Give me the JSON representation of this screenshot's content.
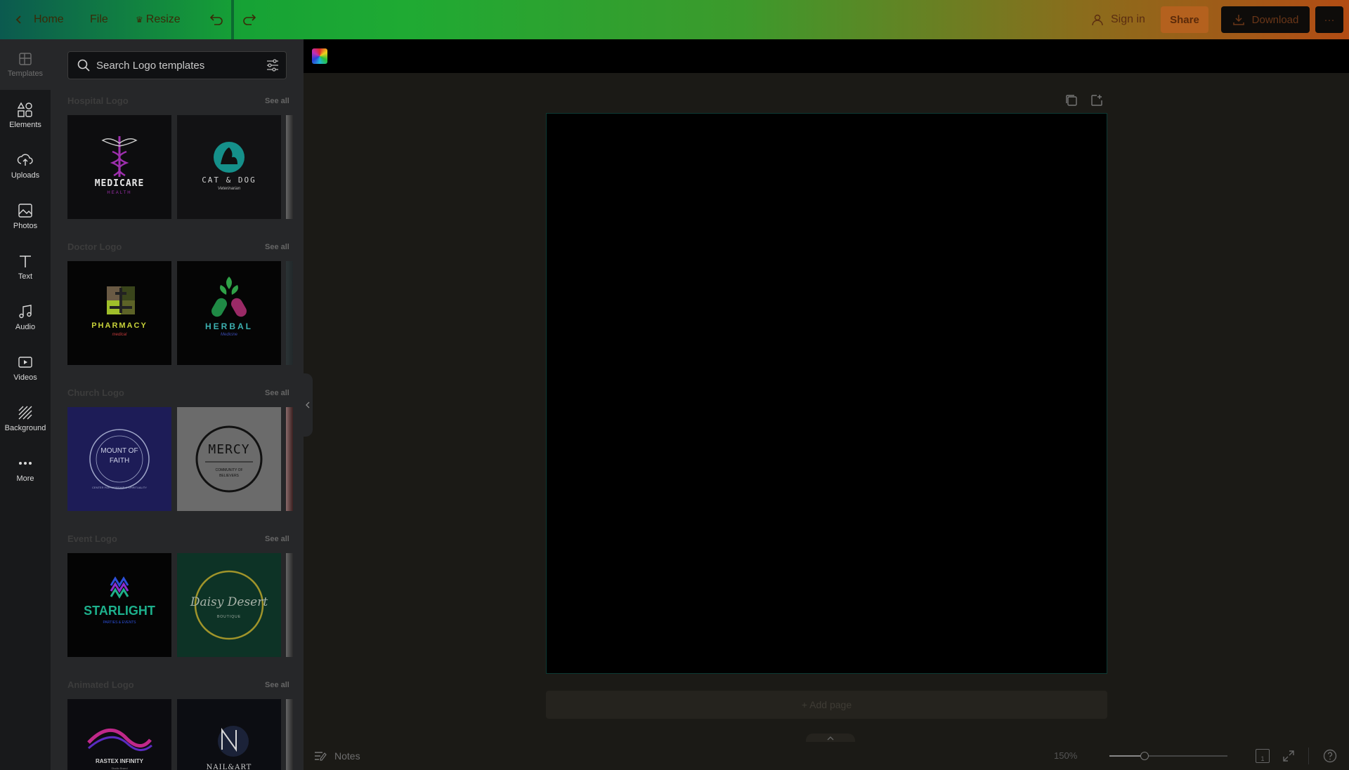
{
  "topbar": {
    "home_label": "Home",
    "file_label": "File",
    "resize_label": "Resize",
    "signin_label": "Sign in",
    "share_label": "Share",
    "download_label": "Download",
    "more_label": "···"
  },
  "rail": {
    "items": [
      {
        "label": "Templates",
        "icon": "templates-icon"
      },
      {
        "label": "Elements",
        "icon": "elements-icon"
      },
      {
        "label": "Uploads",
        "icon": "uploads-icon"
      },
      {
        "label": "Photos",
        "icon": "photos-icon"
      },
      {
        "label": "Text",
        "icon": "text-icon"
      },
      {
        "label": "Audio",
        "icon": "audio-icon"
      },
      {
        "label": "Videos",
        "icon": "videos-icon"
      },
      {
        "label": "Background",
        "icon": "background-icon"
      },
      {
        "label": "More",
        "icon": "more-icon"
      }
    ]
  },
  "panel": {
    "search_placeholder": "Search Logo templates",
    "see_all": "See all",
    "sections": [
      {
        "title": "Hospital Logo",
        "cards": [
          {
            "line1": "MEDICARE",
            "line2": "HEALTH"
          },
          {
            "line1": "CAT & DOG",
            "line2": "Veterinarian"
          }
        ]
      },
      {
        "title": "Doctor Logo",
        "cards": [
          {
            "line1": "PHARMACY",
            "line2": "medical"
          },
          {
            "line1": "HERBAL",
            "line2": "Medicine"
          }
        ]
      },
      {
        "title": "Church Logo",
        "cards": [
          {
            "line1": "MOUNT OF FAITH",
            "line2": "CENTER FOR WORSHIP & SPIRITUALITY"
          },
          {
            "line1": "MERCY",
            "line2": "COMMUNITY OF BELIEVERS"
          }
        ]
      },
      {
        "title": "Event Logo",
        "cards": [
          {
            "line1": "STARLIGHT",
            "line2": "PARTIES & EVENTS"
          },
          {
            "line1": "Daisy Desert",
            "line2": "BOUTIQUE"
          }
        ]
      },
      {
        "title": "Animated Logo",
        "cards": [
          {
            "line1": "RASTEX INFINITY",
            "line2": "Studio Brand"
          },
          {
            "line1": "NAIL&ART",
            "line2": ""
          }
        ]
      }
    ]
  },
  "canvas": {
    "add_page_label": "+ Add page"
  },
  "bottombar": {
    "notes_label": "Notes",
    "zoom_label": "150%",
    "zoom_value": 0.3,
    "page_number": "1"
  }
}
